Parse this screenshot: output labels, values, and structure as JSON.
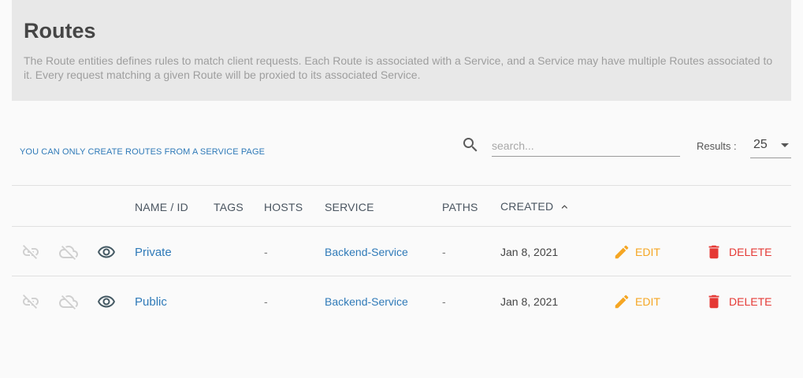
{
  "header": {
    "title": "Routes",
    "description": "The Route entities defines rules to match client requests. Each Route is associated with a Service, and a Service may have multiple Routes associated to it. Every request matching a given Route will be proxied to its associated Service."
  },
  "toolbar": {
    "notice": "YOU CAN ONLY CREATE ROUTES FROM A SERVICE PAGE",
    "search_placeholder": "search...",
    "results_label": "Results :",
    "results_value": "25"
  },
  "table": {
    "columns": [
      "NAME / ID",
      "TAGS",
      "HOSTS",
      "SERVICE",
      "PATHS",
      "CREATED"
    ],
    "rows": [
      {
        "name": "Private",
        "tags": "",
        "hosts": "-",
        "service": "Backend-Service",
        "paths": "-",
        "created": "Jan 8, 2021",
        "edit": "EDIT",
        "delete": "DELETE"
      },
      {
        "name": "Public",
        "tags": "",
        "hosts": "-",
        "service": "Backend-Service",
        "paths": "-",
        "created": "Jan 8, 2021",
        "edit": "EDIT",
        "delete": "DELETE"
      }
    ]
  },
  "colors": {
    "link": "#2f7ab8",
    "edit": "#f5a623",
    "delete": "#e53935",
    "header_bg": "#e8e8e8",
    "page_bg": "#fafafa"
  }
}
